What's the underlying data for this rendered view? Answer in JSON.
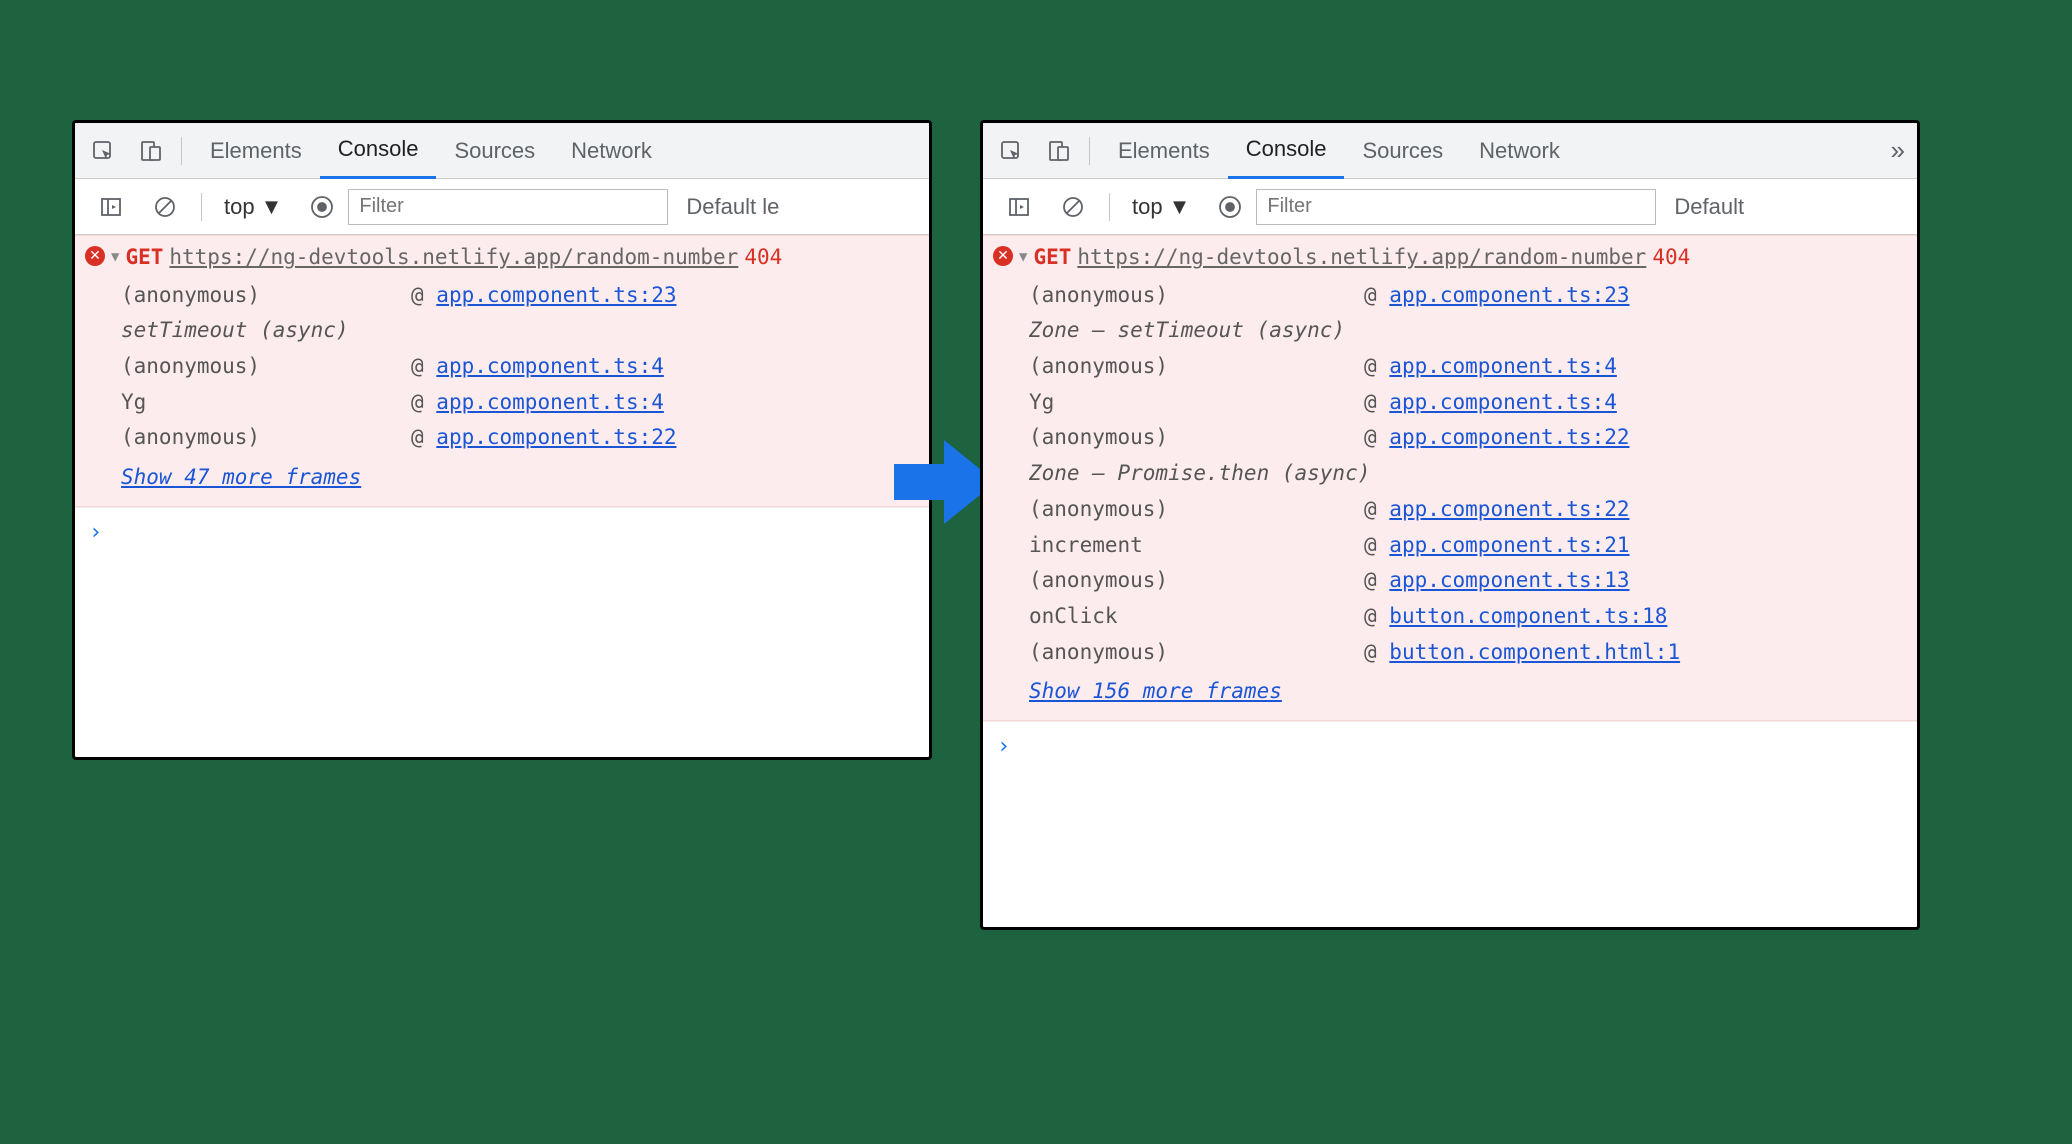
{
  "tabs": {
    "elements": "Elements",
    "console": "Console",
    "sources": "Sources",
    "network": "Network"
  },
  "toolbar": {
    "context": "top",
    "filter_placeholder": "Filter",
    "levels_left": "Default le",
    "levels_right": "Default"
  },
  "left": {
    "method": "GET",
    "url": "https://ng-devtools.netlify.app/random-number",
    "status": "404",
    "async1": "setTimeout (async)",
    "frames": [
      {
        "fn": "(anonymous)",
        "loc": "app.component.ts:23"
      },
      {
        "fn": "(anonymous)",
        "loc": "app.component.ts:4"
      },
      {
        "fn": "Yg",
        "loc": "app.component.ts:4"
      },
      {
        "fn": "(anonymous)",
        "loc": "app.component.ts:22"
      }
    ],
    "showmore": "Show 47 more frames"
  },
  "right": {
    "method": "GET",
    "url": "https://ng-devtools.netlify.app/random-number",
    "status": "404",
    "async1": "Zone — setTimeout (async)",
    "async2": "Zone — Promise.then (async)",
    "group1": [
      {
        "fn": "(anonymous)",
        "loc": "app.component.ts:23"
      }
    ],
    "group2": [
      {
        "fn": "(anonymous)",
        "loc": "app.component.ts:4"
      },
      {
        "fn": "Yg",
        "loc": "app.component.ts:4"
      },
      {
        "fn": "(anonymous)",
        "loc": "app.component.ts:22"
      }
    ],
    "group3": [
      {
        "fn": "(anonymous)",
        "loc": "app.component.ts:22"
      },
      {
        "fn": "increment",
        "loc": "app.component.ts:21"
      },
      {
        "fn": "(anonymous)",
        "loc": "app.component.ts:13"
      },
      {
        "fn": "onClick",
        "loc": "button.component.ts:18"
      },
      {
        "fn": "(anonymous)",
        "loc": "button.component.html:1"
      }
    ],
    "showmore": "Show 156 more frames"
  }
}
